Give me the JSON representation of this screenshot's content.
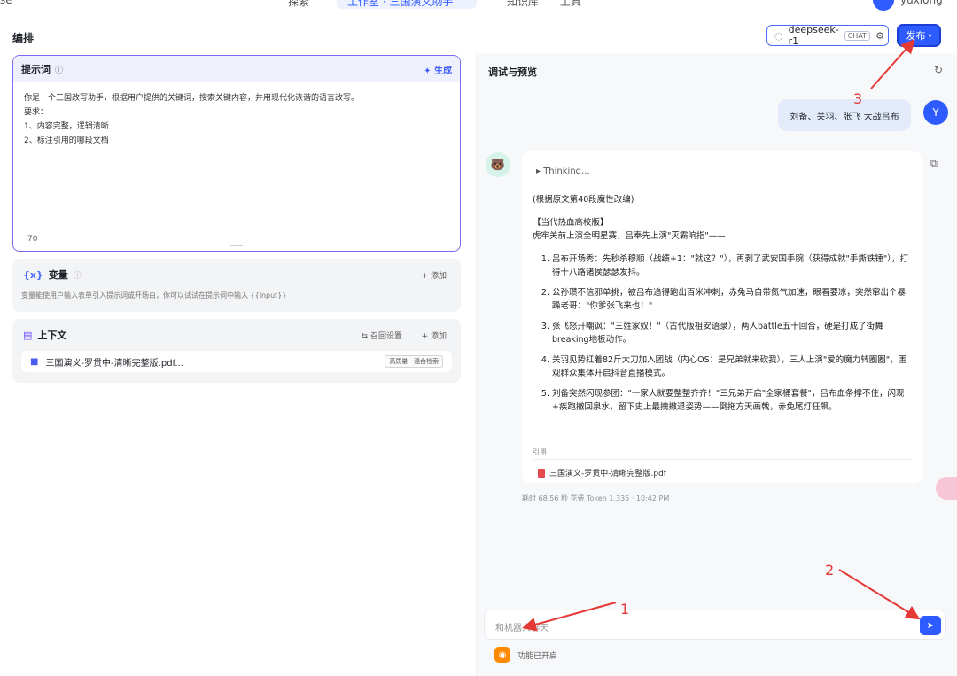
{
  "topbar": {
    "left_text": "se",
    "tab1": "探索",
    "tab2": "工作室 · 三国演义助手",
    "tab3": "知识库",
    "tab4": "工具",
    "username": "yuxiong"
  },
  "page": {
    "title": "编排"
  },
  "model": {
    "name": "deepseek-r1",
    "badge": "CHAT"
  },
  "publish": {
    "label": "发布"
  },
  "prompt": {
    "title": "提示词",
    "generate": "生成",
    "lines": [
      "你是一个三国改写助手，根据用户提供的关键词，搜索关键内容，并用现代化诙谐的语言改写。",
      "要求：",
      "1、内容完整，逻辑清晰",
      "2、标注引用的哪段文档"
    ],
    "count": "70"
  },
  "variables": {
    "title": "变量",
    "add": "添加",
    "desc": "变量能使用户输入表单引入提示词或开场白，你可以试试在提示词中输入 {{input}}"
  },
  "context": {
    "title": "上下文",
    "recall": "召回设置",
    "add": "添加",
    "file": "三国演义-罗贯中-清晰完整版.pdf...",
    "tags": "高质量 · 混合检索"
  },
  "debug": {
    "title": "调试与预览",
    "user_avatar": "Y",
    "user_msg": "刘备、关羽、张飞 大战吕布",
    "thinking": "Thinking...",
    "answer": {
      "intro": "(根据原文第40段魔性改编)",
      "heading": "【当代热血高校版】",
      "lead": "虎牢关前上演全明星赛，吕奉先上演\"灭霸响指\"——",
      "items": [
        "吕布开场秀：先秒杀穆顺（战绩+1：\"就这？\"），再剥了武安国手腕（获得成就\"手撕铁锤\"），打得十八路诸侯瑟瑟发抖。",
        "公孙瓒不信邪单挑，被吕布追得跑出百米冲刺，赤兔马自带氮气加速，眼看要凉，突然窜出个暴躁老哥：\"你爹张飞来也！\"",
        "张飞怒开嘲讽：\"三姓家奴！\"（古代版祖安语录），两人battle五十回合，硬是打成了街舞breaking地板动作。",
        "关羽见势扛着82斤大刀加入团战（内心OS：是兄弟就来砍我），三人上演\"爱的魔力转圈圈\"，围观群众集体开启抖音直播模式。",
        "刘备突然闪现参团：\"一家人就要整整齐齐！\"三兄弟开启\"全家桶套餐\"，吕布血条撑不住，闪现+疾跑撤回泉水，留下史上最拽撤退姿势——倒拖方天画戟，赤兔尾灯狂飙。"
      ]
    },
    "ref_label": "引用",
    "ref_file": "三国演义-罗贯中-清晰完整版.pdf",
    "meta": "耗时 68.56 秒  花费 Token 1,335  ·  10:42 PM",
    "input_placeholder": "和机器人聊天",
    "feature": "功能已开启"
  },
  "annotations": {
    "a1": "1",
    "a2": "2",
    "a3": "3"
  },
  "colors": {
    "accent": "#2e5bff",
    "annotation": "#e53935",
    "prompt_border": "#7c6bf2"
  }
}
